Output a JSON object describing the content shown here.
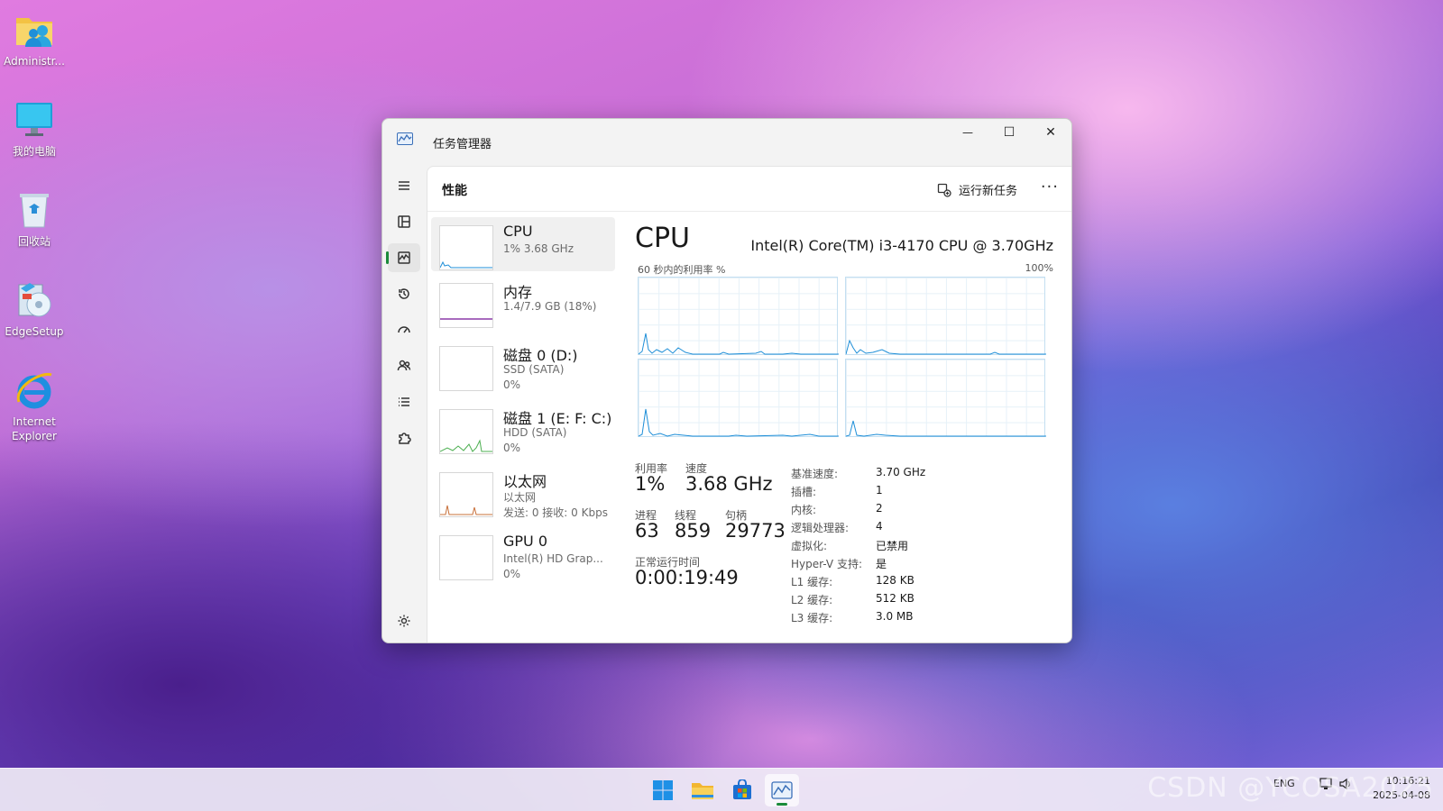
{
  "desktop": {
    "icons": [
      {
        "label": "Administr..."
      },
      {
        "label": "我的电脑"
      },
      {
        "label": "回收站"
      },
      {
        "label": "EdgeSetup"
      },
      {
        "label": "Internet Explorer"
      }
    ]
  },
  "window": {
    "title": "任务管理器",
    "controls": {
      "minimize": "—",
      "maximize": "☐",
      "close": "✕"
    }
  },
  "header": {
    "page_title": "性能",
    "run_task_label": "运行新任务",
    "more_label": "···"
  },
  "devices": [
    {
      "name": "CPU",
      "sub1": "1% 3.68 GHz"
    },
    {
      "name": "内存",
      "sub1": "1.4/7.9 GB (18%)"
    },
    {
      "name": "磁盘 0 (D:)",
      "sub1": "SSD (SATA)",
      "sub2": "0%"
    },
    {
      "name": "磁盘 1 (E: F: C:)",
      "sub1": "HDD (SATA)",
      "sub2": "0%"
    },
    {
      "name": "以太网",
      "sub1": "以太网",
      "sub2": "发送: 0 接收: 0 Kbps"
    },
    {
      "name": "GPU 0",
      "sub1": "Intel(R) HD Grap...",
      "sub2": "0%"
    }
  ],
  "cpu": {
    "title": "CPU",
    "model": "Intel(R) Core(TM) i3-4170 CPU @ 3.70GHz",
    "graph_label": "60 秒内的利用率 %",
    "graph_max": "100%",
    "utilization_label": "利用率",
    "utilization": "1%",
    "speed_label": "速度",
    "speed": "3.68 GHz",
    "processes_label": "进程",
    "processes": "63",
    "threads_label": "线程",
    "threads": "859",
    "handles_label": "句柄",
    "handles": "29773",
    "uptime_label": "正常运行时间",
    "uptime": "0:00:19:49",
    "specs": [
      {
        "k": "基准速度:",
        "v": "3.70 GHz"
      },
      {
        "k": "插槽:",
        "v": "1"
      },
      {
        "k": "内核:",
        "v": "2"
      },
      {
        "k": "逻辑处理器:",
        "v": "4"
      },
      {
        "k": "虚拟化:",
        "v": "已禁用"
      },
      {
        "k": "Hyper-V 支持:",
        "v": "是"
      },
      {
        "k": "L1 缓存:",
        "v": "128 KB"
      },
      {
        "k": "L2 缓存:",
        "v": "512 KB"
      },
      {
        "k": "L3 缓存:",
        "v": "3.0 MB"
      }
    ]
  },
  "taskbar": {
    "tray_lang": "ENG",
    "time": "10:16:21",
    "date": "2025-04-08"
  },
  "watermark": "CSDN @YCOSA2025",
  "colors": {
    "accent": "#1a8a3a",
    "cpu_line": "#1f8fd8",
    "memory_line": "#8b3aa8",
    "disk1_line": "#4caf50",
    "ethernet_line": "#c8703a"
  }
}
